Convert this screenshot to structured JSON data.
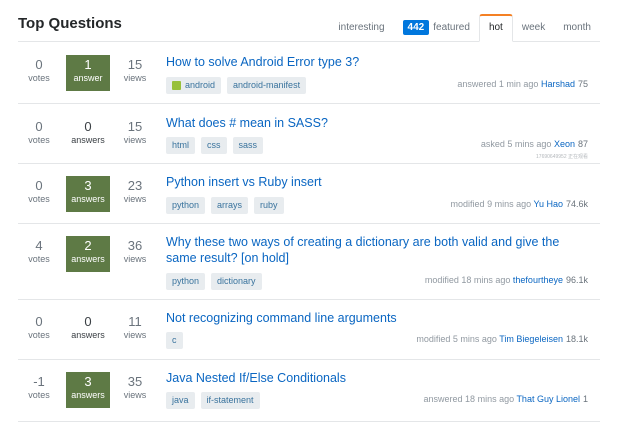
{
  "header": {
    "title": "Top Questions",
    "tabs": [
      {
        "label": "interesting"
      },
      {
        "badge": "442",
        "label": "featured"
      },
      {
        "label": "hot",
        "active": true
      },
      {
        "label": "week"
      },
      {
        "label": "month"
      }
    ]
  },
  "questions": [
    {
      "votes": "0",
      "votes_label": "votes",
      "answers": "1",
      "answers_label": "answer",
      "answered": true,
      "views": "15",
      "views_label": "views",
      "title": "How to solve Android Error type 3?",
      "tags": [
        "android",
        "android-manifest"
      ],
      "action": "answered 1 min ago",
      "user": "Harshad",
      "rep": "75"
    },
    {
      "votes": "0",
      "votes_label": "votes",
      "answers": "0",
      "answers_label": "answers",
      "answered": false,
      "views": "15",
      "views_label": "views",
      "title": "What does # mean in SASS?",
      "tags": [
        "html",
        "css",
        "sass"
      ],
      "action": "asked 5 mins ago",
      "user": "Xeon",
      "rep": "87",
      "note": "17690649952 正在观看"
    },
    {
      "votes": "0",
      "votes_label": "votes",
      "answers": "3",
      "answers_label": "answers",
      "answered": true,
      "views": "23",
      "views_label": "views",
      "title": "Python insert vs Ruby insert",
      "tags": [
        "python",
        "arrays",
        "ruby"
      ],
      "action": "modified 9 mins ago",
      "user": "Yu Hao",
      "rep": "74.6k"
    },
    {
      "votes": "4",
      "votes_label": "votes",
      "answers": "2",
      "answers_label": "answers",
      "answered": true,
      "views": "36",
      "views_label": "views",
      "title_line1": "Why these two ways of creating a dictionary are both valid and give the",
      "title_line2": "same result? [on hold]",
      "tags": [
        "python",
        "dictionary"
      ],
      "action": "modified 18 mins ago",
      "user": "thefourtheye",
      "rep": "96.1k"
    },
    {
      "votes": "0",
      "votes_label": "votes",
      "answers": "0",
      "answers_label": "answers",
      "answered": false,
      "views": "11",
      "views_label": "views",
      "title": "Not recognizing command line arguments",
      "tags": [
        "c"
      ],
      "action": "modified 5 mins ago",
      "user": "Tim Biegeleisen",
      "rep": "18.1k"
    },
    {
      "votes": "-1",
      "votes_label": "votes",
      "answers": "3",
      "answers_label": "answers",
      "answered": true,
      "views": "35",
      "views_label": "views",
      "title": "Java Nested If/Else Conditionals",
      "tags": [
        "java",
        "if-statement"
      ],
      "action": "answered 18 mins ago",
      "user": "That Guy Lionel",
      "rep": "1"
    }
  ],
  "colors": {
    "accent_tab": "#f48024",
    "answered_bg": "#5e7a45",
    "link": "#0a66c2",
    "tag_bg": "#e8ecef",
    "bounty": "#0077dd"
  }
}
